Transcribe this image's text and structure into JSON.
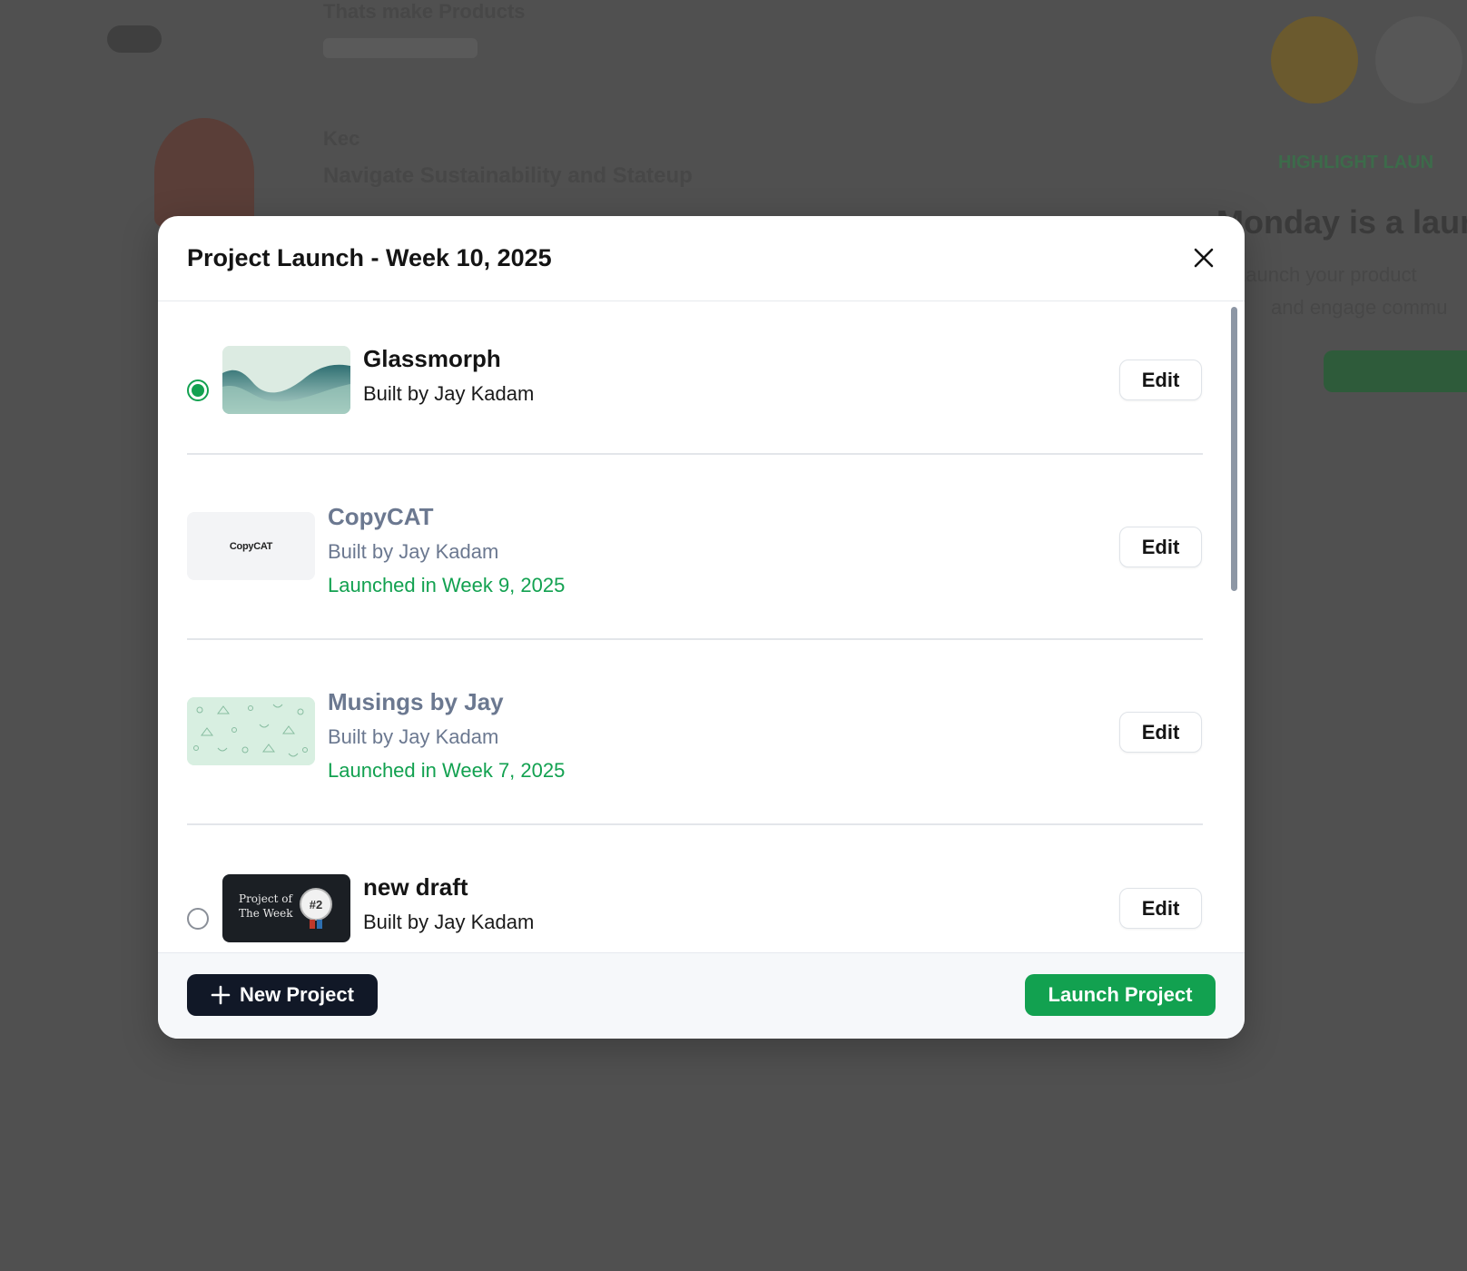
{
  "background": {
    "row1_title": "Thats make Products",
    "row2_author": "Kec",
    "row2_title": "Navigate Sustainability and Stateup",
    "right_badge_label": "HIGHLIGHT LAUN",
    "right_heading": "Monday is a launc",
    "right_line1": "Launch your product",
    "right_line2": "and engage commu"
  },
  "modal": {
    "title": "Project Launch - Week 10, 2025",
    "close_icon": "close-icon"
  },
  "projects": [
    {
      "name": "Glassmorph",
      "author": "Built by Jay Kadam",
      "status": "",
      "selectable": true,
      "selected": true,
      "edit_label": "Edit"
    },
    {
      "name": "CopyCAT",
      "author": "Built by Jay Kadam",
      "status": "Launched in Week 9, 2025",
      "thumb_text": "CopyCAT",
      "selectable": false,
      "edit_label": "Edit"
    },
    {
      "name": "Musings by Jay",
      "author": "Built by Jay Kadam",
      "status": "Launched in Week 7, 2025",
      "selectable": false,
      "edit_label": "Edit"
    },
    {
      "name": "new draft",
      "author": "Built by Jay Kadam",
      "status": "",
      "thumb_line1": "Project of",
      "thumb_line2": "The Week",
      "thumb_badge": "#2",
      "selectable": true,
      "selected": false,
      "edit_label": "Edit"
    }
  ],
  "footer": {
    "new_project_label": "New Project",
    "launch_label": "Launch Project"
  },
  "colors": {
    "accent_green": "#12a150",
    "dark_button": "#111827",
    "muted_text": "#6b7890",
    "overlay": "#505050"
  }
}
